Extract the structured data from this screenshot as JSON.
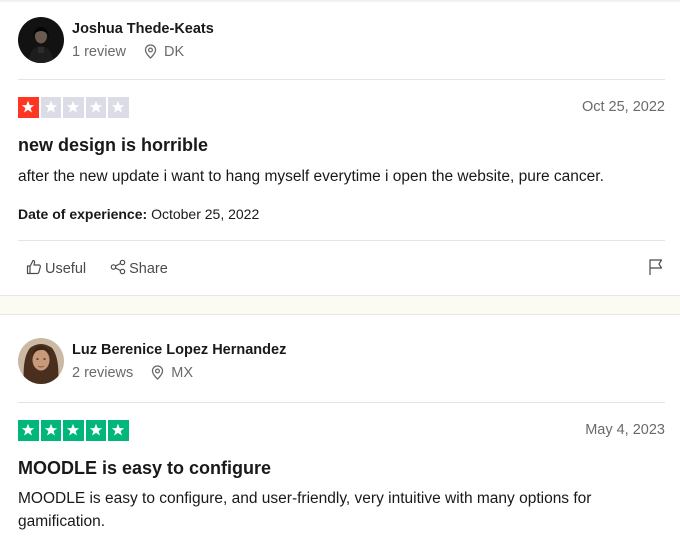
{
  "reviews": [
    {
      "consumer": {
        "name": "Joshua Thede-Keats",
        "review_count": "1 review",
        "country": "DK"
      },
      "rating": 1,
      "date": "Oct 25, 2022",
      "title": "new design is horrible",
      "body": "after the new update i want to hang myself everytime i open the website, pure cancer.",
      "experience_label": "Date of experience:",
      "experience_date": "October 25, 2022",
      "actions": {
        "useful": "Useful",
        "share": "Share"
      }
    },
    {
      "consumer": {
        "name": "Luz Berenice Lopez Hernandez",
        "review_count": "2 reviews",
        "country": "MX"
      },
      "rating": 5,
      "date": "May 4, 2023",
      "title": "MOODLE is easy to configure",
      "body": "MOODLE is easy to configure, and user-friendly, very intuitive with many options for gamification."
    }
  ],
  "colors": {
    "star_1": "#ff3722",
    "star_5": "#00b67a",
    "star_empty": "#dcdce6",
    "background": "#fcfbf3"
  },
  "icons": [
    "location-pin-icon",
    "thumbs-up-icon",
    "share-icon",
    "flag-icon",
    "star-icon"
  ]
}
